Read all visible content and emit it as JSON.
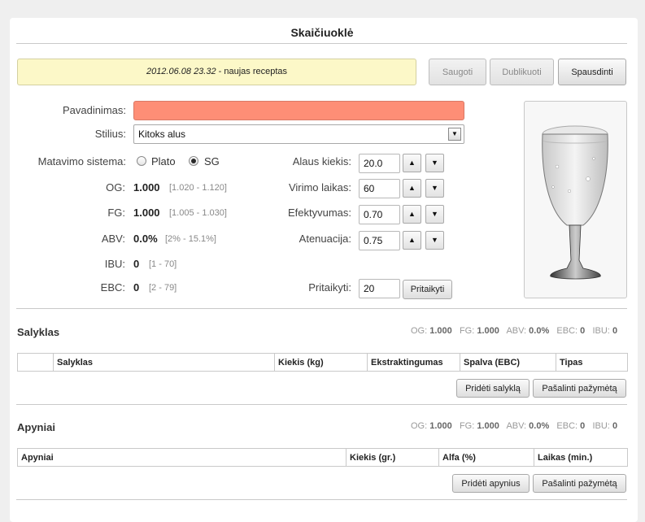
{
  "title": "Skaičiuoklė",
  "notice": {
    "date": "2012.06.08 23.32",
    "text": " - naujas receptas"
  },
  "toolbar": {
    "save": "Saugoti",
    "duplicate": "Dublikuoti",
    "print": "Spausdinti"
  },
  "form": {
    "name_label": "Pavadinimas:",
    "name_value": "",
    "style_label": "Stilius:",
    "style_value": "Kitoks alus",
    "system_label": "Matavimo sistema:",
    "system_options": [
      "Plato",
      "SG"
    ],
    "system_selected": "SG",
    "og": {
      "label": "OG:",
      "value": "1.000",
      "range": "[1.020 - 1.120]"
    },
    "fg": {
      "label": "FG:",
      "value": "1.000",
      "range": "[1.005 - 1.030]"
    },
    "abv": {
      "label": "ABV:",
      "value": "0.0%",
      "range": "[2% - 15.1%]"
    },
    "ibu": {
      "label": "IBU:",
      "value": "0",
      "range": "[1 - 70]"
    },
    "ebc": {
      "label": "EBC:",
      "value": "0",
      "range": "[2 - 79]"
    },
    "amount": {
      "label": "Alaus kiekis:",
      "value": "20.0"
    },
    "boil": {
      "label": "Virimo laikas:",
      "value": "60"
    },
    "efficiency": {
      "label": "Efektyvumas:",
      "value": "0.70"
    },
    "attenuation": {
      "label": "Atenuacija:",
      "value": "0.75"
    },
    "apply": {
      "label": "Pritaikyti:",
      "value": "20",
      "button": "Pritaikyti"
    },
    "spin_up": "▲",
    "spin_down": "▼"
  },
  "image": {
    "icon": "beer-glass-icon"
  },
  "malts": {
    "title": "Salyklas",
    "stats": {
      "og": "1.000",
      "fg": "1.000",
      "abv": "0.0%",
      "ebc": "0",
      "ibu": "0"
    },
    "columns": [
      "",
      "Salyklas",
      "Kiekis (kg)",
      "Ekstraktingumas",
      "Spalva (EBC)",
      "Tipas"
    ],
    "add_button": "Pridėti salyklą",
    "remove_button": "Pašalinti pažymėtą"
  },
  "hops": {
    "title": "Apyniai",
    "stats": {
      "og": "1.000",
      "fg": "1.000",
      "abv": "0.0%",
      "ebc": "0",
      "ibu": "0"
    },
    "columns": [
      "Apyniai",
      "Kiekis (gr.)",
      "Alfa (%)",
      "Laikas (min.)"
    ],
    "add_button": "Pridėti apynius",
    "remove_button": "Pašalinti pažymėtą"
  },
  "stat_labels": {
    "og": "OG:",
    "fg": "FG:",
    "abv": "ABV:",
    "ebc": "EBC:",
    "ibu": "IBU:"
  },
  "colors": {
    "name_invalid": "#fe8e76",
    "notice_bg": "#fcf8c8"
  }
}
